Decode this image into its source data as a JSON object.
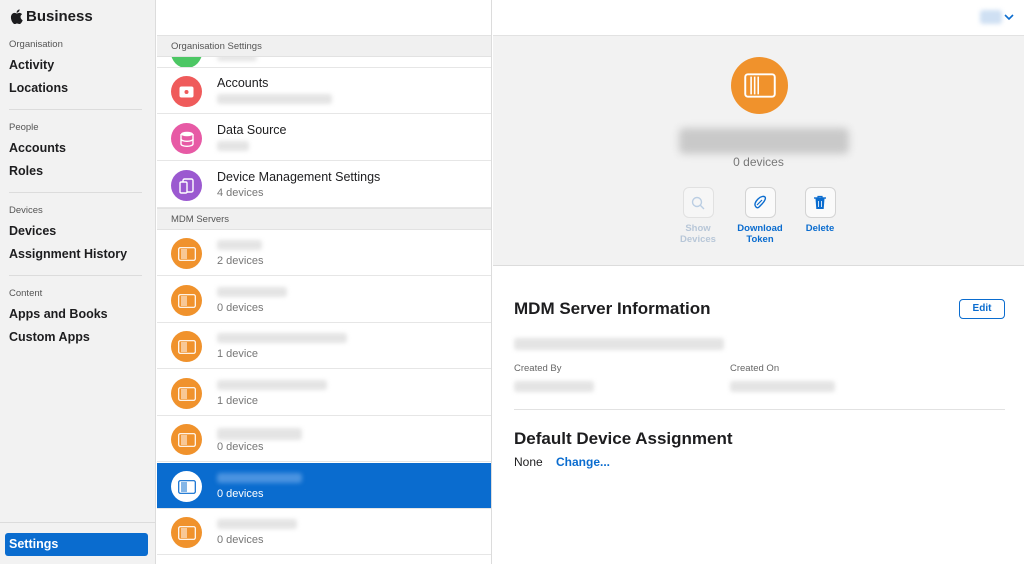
{
  "brand": {
    "name": "Business"
  },
  "sidebar": {
    "sections": [
      {
        "label": "Organisation",
        "items": [
          "Activity",
          "Locations"
        ]
      },
      {
        "label": "People",
        "items": [
          "Accounts",
          "Roles"
        ]
      },
      {
        "label": "Devices",
        "items": [
          "Devices",
          "Assignment History"
        ]
      },
      {
        "label": "Content",
        "items": [
          "Apps and Books",
          "Custom Apps"
        ]
      }
    ],
    "settings_label": "Settings"
  },
  "list": {
    "org_header": "Organisation Settings",
    "accounts": {
      "title": "Accounts"
    },
    "data_source": {
      "title": "Data Source"
    },
    "device_mgmt": {
      "title": "Device Management Settings",
      "subtitle": "4 devices"
    },
    "mdm_header": "MDM Servers",
    "servers": [
      {
        "subtitle": "2 devices"
      },
      {
        "subtitle": "0 devices"
      },
      {
        "subtitle": "1 device"
      },
      {
        "subtitle": "1 device"
      },
      {
        "subtitle": "0 devices"
      },
      {
        "subtitle": "0 devices"
      },
      {
        "subtitle": "0 devices"
      }
    ]
  },
  "detail": {
    "device_count": "0 devices",
    "actions": {
      "show_devices": "Show Devices",
      "download_token": "Download Token",
      "delete": "Delete"
    },
    "info_title": "MDM Server Information",
    "edit_label": "Edit",
    "created_by_label": "Created By",
    "created_on_label": "Created On",
    "assign_title": "Default Device Assignment",
    "assign_value": "None",
    "assign_change": "Change..."
  },
  "colors": {
    "accent": "#0a6ccf",
    "server_icon": "#f0922c",
    "accounts_icon": "#ef5b5b",
    "data_source_icon": "#e75aa5",
    "device_mgmt_icon": "#9b59d0",
    "top_green": "#4cc764"
  }
}
